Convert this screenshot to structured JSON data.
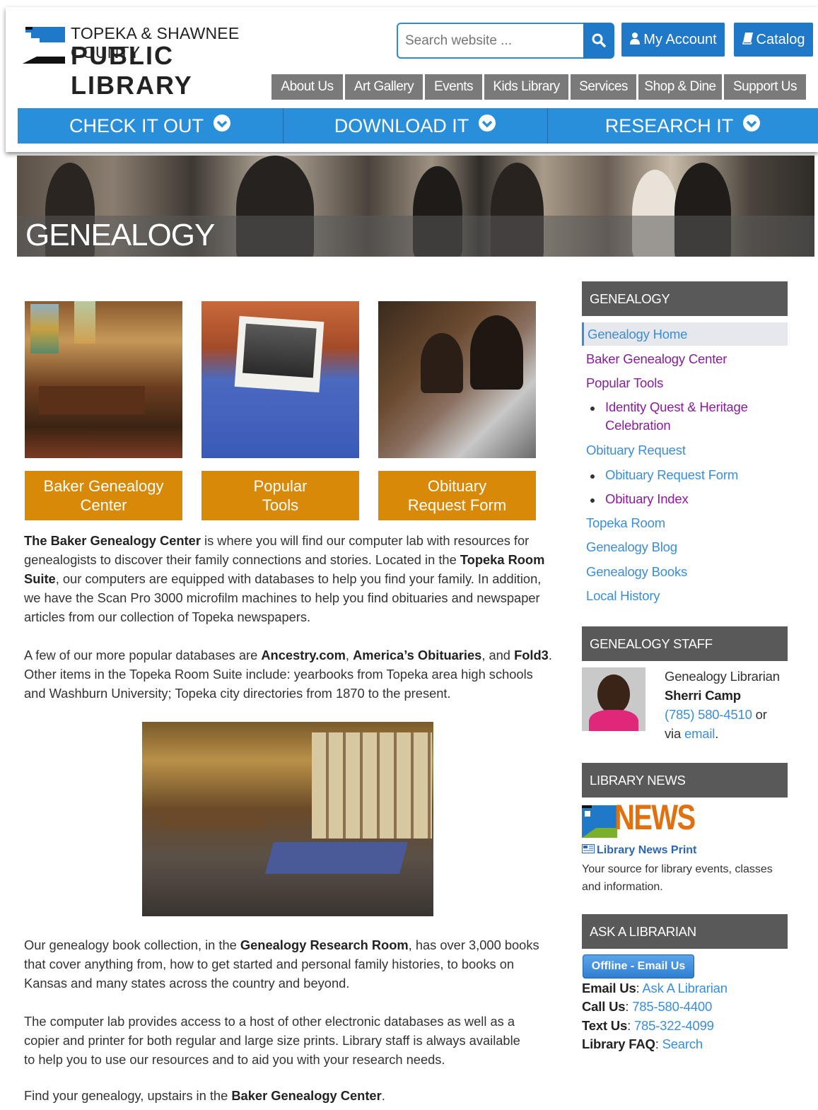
{
  "header": {
    "logo_line1": "TOPEKA & SHAWNEE COUNTY",
    "logo_line2": "PUBLIC LIBRARY",
    "search_placeholder": "Search website ...",
    "account_label": "My Account",
    "catalog_label": "Catalog"
  },
  "nav": {
    "items": [
      "About Us",
      "Art Gallery",
      "Events",
      "Kids Library",
      "Services",
      "Shop & Dine",
      "Support Us"
    ]
  },
  "bluebar": {
    "items": [
      "CHECK IT OUT",
      "DOWNLOAD IT",
      "RESEARCH IT"
    ]
  },
  "banner": {
    "title": "GENEALOGY"
  },
  "tiles": [
    {
      "line1": "Baker Genealogy",
      "line2": "Center"
    },
    {
      "line1": "Popular",
      "line2": "Tools"
    },
    {
      "line1": "Obituary",
      "line2": "Request Form"
    }
  ],
  "content": {
    "p1": {
      "b1": "The Baker Genealogy Center",
      "t1": " is where you will find our computer lab with resources for genealogists to discover their family connections and stories. Located in the ",
      "b2": "Topeka Room Suite",
      "t2": ", our computers are equipped with databases to help you find your family. In addition, we have the Scan Pro 3000 microfilm machines to help you find obituaries and newspaper articles from our collection of Topeka newspapers."
    },
    "p2": {
      "t1": "A few of our more popular databases are ",
      "b1": "Ancestry.com",
      "t2": ", ",
      "b2": "America’s Obituaries",
      "t3": ", and ",
      "b3": "Fold3",
      "t4": ". Other items in the Topeka Room Suite include: yearbooks from Topeka area high schools and Washburn University; Topeka city directories from 1870 to the present."
    },
    "p3": {
      "t1": "Our genealogy book collection, in the ",
      "b1": "Genealogy Research Room",
      "t2": ", has over 3,000 books that cover anything from, how to get started and personal family histories, to books on Kansas and many states across the country and beyond."
    },
    "p4": {
      "t1": "The computer lab provides access to a host of other electronic databases as well as a copier and printer for both regular and large size prints.  Library staff is always available to help you to use our resources and to aid you with your research needs."
    },
    "p5": {
      "t1": "Find your genealogy, upstairs in the ",
      "b1": "Baker Genealogy Center",
      "t2": "."
    }
  },
  "sidebar": {
    "genealogy_head": "GENEALOGY",
    "links": {
      "home": "Genealogy Home",
      "baker": "Baker Genealogy Center",
      "tools": "Popular Tools",
      "identity1": "Identity Quest & Heritage",
      "identity2": "Celebration",
      "obit_request": "Obituary Request",
      "obit_form": "Obituary Request Form",
      "obit_index": "Obituary Index",
      "topeka_room": "Topeka Room",
      "blog": "Genealogy Blog",
      "books": "Genealogy Books",
      "local": "Local History"
    },
    "staff_head": "GENEALOGY STAFF",
    "staff": {
      "title": "Genealogy Librarian",
      "name": "Sherri Camp",
      "phone": "(785) 580-4510",
      "or": " or",
      "via": "via ",
      "email": "email",
      "period": "."
    },
    "news_head": "LIBRARY NEWS",
    "news": {
      "logo_text": "NEWS",
      "print": "Library News Print",
      "desc": "Your source for library events, classes and information."
    },
    "ask_head": "ASK A LIBRARIAN",
    "ask": {
      "offline": "Offline - Email Us",
      "email_label": "Email Us",
      "email_value": "Ask A Librarian",
      "call_label": "Call Us",
      "call_value": "785-580-4400",
      "text_label": "Text Us",
      "text_value": "785-322-4099",
      "faq_label": "Library FAQ",
      "faq_value": "Search",
      "colon": ": "
    }
  },
  "colors": {
    "brand_blue": "#1f78c8",
    "bar_blue": "#2a8fdb",
    "nav_gray": "#7a7a7a",
    "tile_orange": "#d88908",
    "side_head": "#595959",
    "link_blue": "#3a8ed8",
    "link_purple": "#8a1c9c"
  }
}
